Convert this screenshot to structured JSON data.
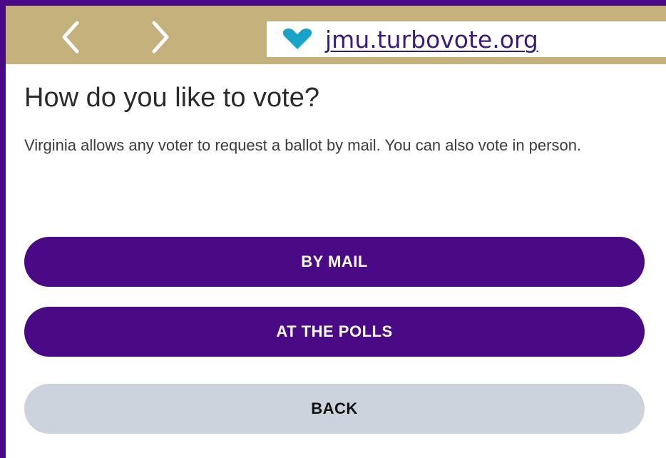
{
  "toolbar": {
    "back_icon": "chevron-left-icon",
    "forward_icon": "chevron-right-icon",
    "url_icon": "heart-icon",
    "url": "jmu.turbovote.org"
  },
  "page": {
    "title": "How do you like to vote?",
    "description": "Virginia allows any voter to request a ballot by mail. You can also vote in person."
  },
  "buttons": {
    "by_mail": "BY MAIL",
    "at_polls": "AT THE POLLS",
    "back": "BACK"
  },
  "colors": {
    "brand_purple": "#4a0a86",
    "toolbar_gold": "#c4b17c",
    "heart_teal": "#1aa3c9",
    "back_button_gray": "#ccd3dd"
  }
}
